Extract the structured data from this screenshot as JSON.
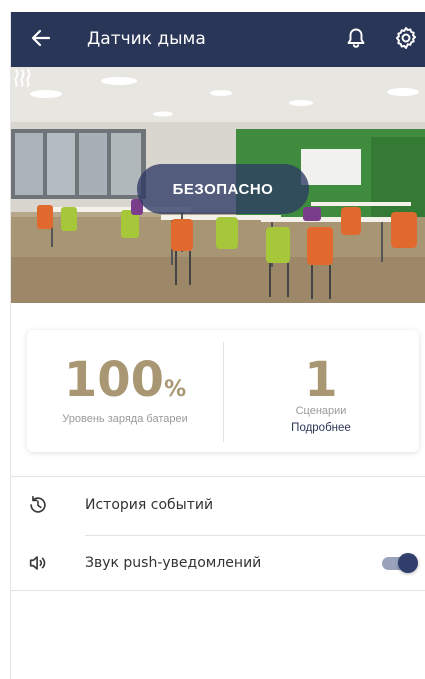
{
  "header": {
    "title": "Датчик дыма",
    "icons": [
      "back-arrow-icon",
      "bell-icon",
      "gear-icon"
    ],
    "background_color": "#2a3658"
  },
  "hero": {
    "status": "БЕЗОПАСНО",
    "corner_icon": "wave-icon"
  },
  "stats": {
    "battery": {
      "value": "100",
      "unit": "%",
      "label": "Уровень заряда батареи"
    },
    "scenarios": {
      "value": "1",
      "label": "Сценарии",
      "link": "Подробнее"
    },
    "value_color": "#a99774"
  },
  "list": {
    "items": [
      {
        "label": "История событий",
        "icon": "history-icon"
      },
      {
        "label": "Звук push-уведомлений",
        "icon": "speaker-icon",
        "toggle_on": true
      }
    ]
  }
}
